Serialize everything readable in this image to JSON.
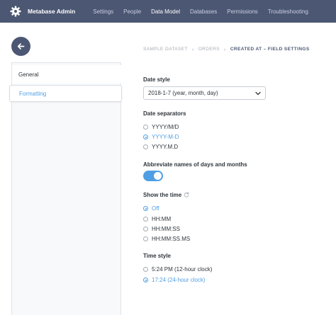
{
  "nav": {
    "brand_title": "Metabase Admin",
    "brand_icon": "gear-icon",
    "links": [
      "Settings",
      "People",
      "Data Model",
      "Databases",
      "Permissions",
      "Troubleshooting"
    ],
    "active": "Data Model",
    "bg_color": "#4c5773"
  },
  "breadcrumb": [
    "SAMPLE DATASET",
    "ORDERS",
    "CREATED AT – FIELD SETTINGS"
  ],
  "sidebar": {
    "items": [
      "General",
      "Formatting"
    ],
    "selected": "Formatting"
  },
  "settings": {
    "date_style": {
      "label": "Date style",
      "value": "2018-1-7 (year, month, day)"
    },
    "date_separators": {
      "label": "Date separators",
      "options": [
        "YYYY/M/D",
        "YYYY-M-D",
        "YYYY.M.D"
      ],
      "selected": "YYYY-M-D"
    },
    "abbreviate": {
      "label": "Abbreviate names of days and months",
      "on": true
    },
    "show_time": {
      "label": "Show the time",
      "options": [
        "Off",
        "HH:MM",
        "HH:MM:SS",
        "HH:MM:SS.MS"
      ],
      "selected": "Off"
    },
    "time_style": {
      "label": "Time style",
      "options": [
        "5:24 PM (12-hour clock)",
        "17:24 (24-hour clock)"
      ],
      "selected": "17:24 (24-hour clock)"
    }
  },
  "colors": {
    "accent": "#509ee3",
    "text": "#2e353b",
    "muted": "#a6acb3"
  }
}
